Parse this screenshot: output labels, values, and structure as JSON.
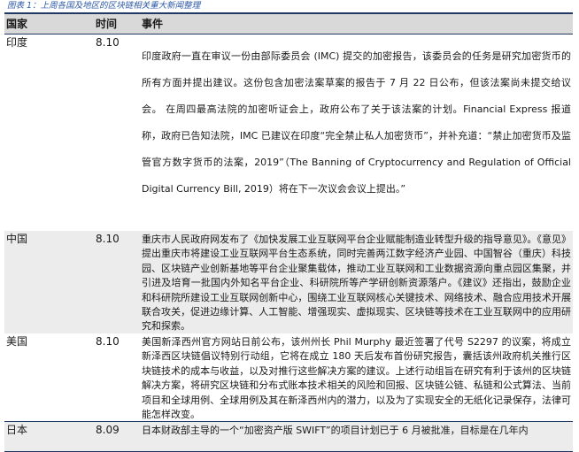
{
  "caption": "图表 1：上周各国及地区的区块链相关重大新闻整理",
  "table": {
    "headers": {
      "country": "国家",
      "time": "时间",
      "event": "事件"
    },
    "rows": [
      {
        "country": "印度",
        "time": "8.10",
        "event": "印度政府一直在审议一份由部际委员会 (IMC) 提交的加密报告，该委员会的任务是研究加密货币的所有方面并提出建议。这份包含加密法案草案的报告于 7 月 22 日公布，但该法案尚未提交给议会。 在周四最高法院的加密听证会上，政府公布了关于该法案的计划。Financial Express 报道称，政府已告知法院，IMC 已建议在印度“完全禁止私人加密货币”，并补充道：“禁止加密货币及监管官方数字货币的法案，2019”（The Banning of Cryptocurrency and Regulation of Official Digital Currency Bill, 2019）将在下一次议会会议上提出。”"
      },
      {
        "country": "中国",
        "time": "8.10",
        "event": "重庆市人民政府网发布了《加快发展工业互联网平台企业赋能制造业转型升级的指导意见》。《意见》提出重庆市将建设工业互联网平台生态系统，同时完善两江数字经济产业园、中国智谷（重庆）科技园、区块链产业创新基地等平台企业聚集载体，推动工业互联网和工业数据资源向重点园区集聚，并引进及培育一批国内外知名平台企业、科研院所等产学研创新资源落户。《建议》还指出，鼓励企业和科研院所建设工业互联网创新中心，围绕工业互联网核心关键技术、网络技术、融合应用技术开展联合攻关，促进边缘计算、人工智能、增强现实、虚拟现实、区块链等技术在工业互联网中的应用研究和探索。"
      },
      {
        "country": "美国",
        "time": "8.10",
        "event": "美国新泽西州官方网站日前公布，该州州长 Phil Murphy 最近签署了代号 S2297 的议案，将成立新泽西区块链倡议特别行动组，它将在成立 180 天后发布首份研究报告，囊括该州政府机关推行区块链技术的成本与收益，以及对推行这些解决方案的建议。上述行动组旨在研究有利于该州的区块链解决方案，将研究区块链和分布式账本技术相关的风险和回报、区块链公链、私链和公式算法、当前项目和全球用例、全球用例及其在新泽西州内的潜力，以及为了实现安全的无纸化记录保存，法律可能怎样改变。"
      },
      {
        "country": "日本",
        "time": "8.09",
        "event": "日本财政部主导的一个“加密资产版 SWIFT”的项目计划已于 6 月被批准，目标是在几年内"
      }
    ]
  }
}
